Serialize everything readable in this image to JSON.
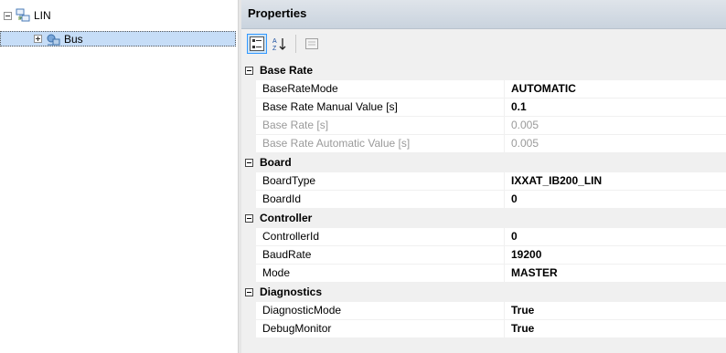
{
  "tree": {
    "root": {
      "label": "LIN",
      "icon": "network-icon"
    },
    "child": {
      "label": "Bus",
      "icon": "bus-icon"
    }
  },
  "properties": {
    "title": "Properties",
    "toolbar": [
      "categorized-view-icon",
      "alphabetical-sort-icon",
      "property-pages-icon"
    ],
    "categories": [
      {
        "name": "Base Rate",
        "rows": [
          {
            "name": "BaseRateMode",
            "value": "AUTOMATIC",
            "enabled": true
          },
          {
            "name": "Base Rate Manual Value [s]",
            "value": "0.1",
            "enabled": true
          },
          {
            "name": "Base Rate [s]",
            "value": "0.005",
            "enabled": false
          },
          {
            "name": "Base Rate Automatic Value [s]",
            "value": "0.005",
            "enabled": false
          }
        ]
      },
      {
        "name": "Board",
        "rows": [
          {
            "name": "BoardType",
            "value": "IXXAT_IB200_LIN",
            "enabled": true
          },
          {
            "name": "BoardId",
            "value": "0",
            "enabled": true
          }
        ]
      },
      {
        "name": "Controller",
        "rows": [
          {
            "name": "ControllerId",
            "value": "0",
            "enabled": true
          },
          {
            "name": "BaudRate",
            "value": "19200",
            "enabled": true
          },
          {
            "name": "Mode",
            "value": "MASTER",
            "enabled": true
          }
        ]
      },
      {
        "name": "Diagnostics",
        "rows": [
          {
            "name": "DiagnosticMode",
            "value": "True",
            "enabled": true
          },
          {
            "name": "DebugMonitor",
            "value": "True",
            "enabled": true
          }
        ]
      }
    ]
  },
  "colors": {
    "selection": "#c6ddf7",
    "header": "#c9d3de",
    "disabled_text": "#9a9a9a"
  }
}
